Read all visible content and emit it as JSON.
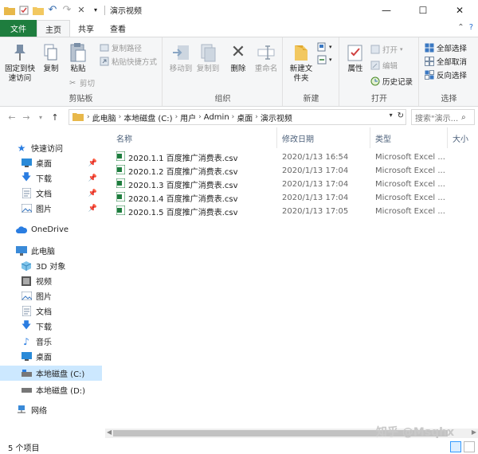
{
  "window": {
    "title": "演示视频",
    "min_glyph": "—",
    "max_glyph": "☐",
    "close_glyph": "✕"
  },
  "tabs": {
    "file": "文件",
    "home": "主页",
    "share": "共享",
    "view": "查看"
  },
  "ribbon": {
    "clipboard": {
      "pin": "固定到快速访问",
      "copy": "复制",
      "paste": "粘贴",
      "copy_path": "复制路径",
      "paste_shortcut": "粘贴快捷方式",
      "cut": "剪切",
      "label": "剪贴板"
    },
    "organize": {
      "move_to": "移动到",
      "copy_to": "复制到",
      "delete": "删除",
      "rename": "重命名",
      "label": "组织"
    },
    "new": {
      "new_folder": "新建文件夹",
      "label": "新建"
    },
    "open": {
      "properties": "属性",
      "open": "打开",
      "edit": "编辑",
      "history": "历史记录",
      "label": "打开"
    },
    "select": {
      "select_all": "全部选择",
      "select_none": "全部取消",
      "invert": "反向选择",
      "label": "选择"
    }
  },
  "address": {
    "crumbs": [
      "此电脑",
      "本地磁盘 (C:)",
      "用户",
      "Admin",
      "桌面",
      "演示视频"
    ],
    "search_placeholder": "搜索\"演示..."
  },
  "nav": {
    "quick_access": "快速访问",
    "qa_items": [
      "桌面",
      "下载",
      "文档",
      "图片"
    ],
    "onedrive": "OneDrive",
    "this_pc": "此电脑",
    "pc_items": [
      "3D 对象",
      "视频",
      "图片",
      "文档",
      "下载",
      "音乐",
      "桌面",
      "本地磁盘 (C:)",
      "本地磁盘 (D:)"
    ],
    "network": "网络"
  },
  "columns": {
    "name": "名称",
    "date": "修改日期",
    "type": "类型",
    "size": "大小"
  },
  "files": [
    {
      "name": "2020.1.1 百度推广消费表.csv",
      "date": "2020/1/13 16:54",
      "type": "Microsoft Excel ..."
    },
    {
      "name": "2020.1.2 百度推广消费表.csv",
      "date": "2020/1/13 17:04",
      "type": "Microsoft Excel ..."
    },
    {
      "name": "2020.1.3 百度推广消费表.csv",
      "date": "2020/1/13 17:04",
      "type": "Microsoft Excel ..."
    },
    {
      "name": "2020.1.4 百度推广消费表.csv",
      "date": "2020/1/13 17:04",
      "type": "Microsoft Excel ..."
    },
    {
      "name": "2020.1.5 百度推广消费表.csv",
      "date": "2020/1/13 17:05",
      "type": "Microsoft Excel ..."
    }
  ],
  "status": {
    "count": "5 个项目"
  },
  "watermark": "知乎 @Msqhx",
  "colors": {
    "file_tab": "#1e7d3e",
    "selection": "#cce8ff",
    "folder": "#e8b84a",
    "accent": "#0a64c8"
  }
}
